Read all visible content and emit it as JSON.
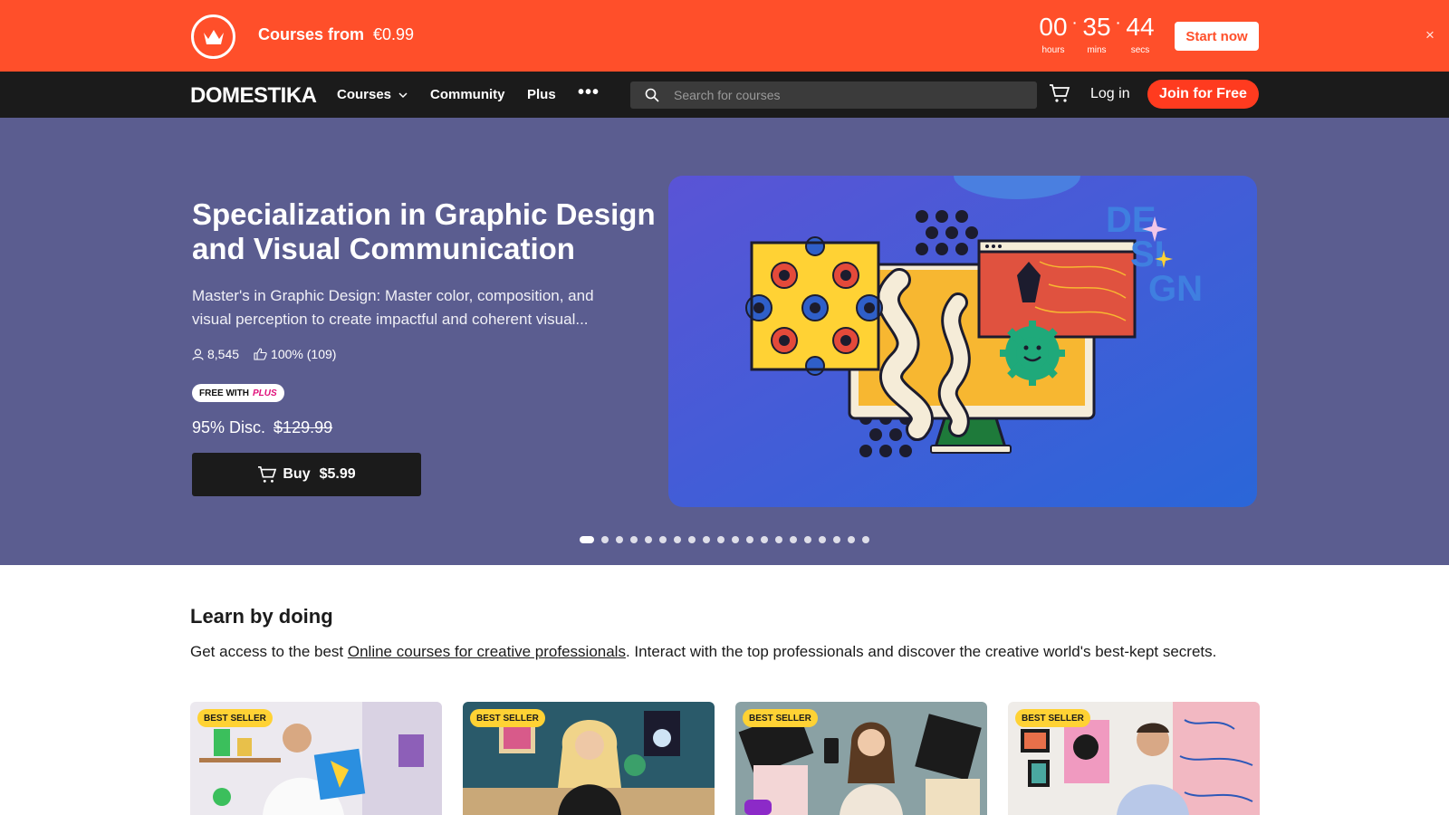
{
  "promo": {
    "title": "Courses from",
    "price": "€0.99",
    "timer": [
      {
        "value": "00",
        "label": "hours"
      },
      {
        "value": "35",
        "label": "mins"
      },
      {
        "value": "44",
        "label": "secs"
      }
    ],
    "cta": "Start now",
    "close": "×"
  },
  "nav": {
    "brand": "DOMESTIKA",
    "items": [
      "Courses",
      "Community",
      "Plus"
    ],
    "more": "•••",
    "search_placeholder": "Search for courses",
    "login": "Log in",
    "join": "Join for Free"
  },
  "hero": {
    "title": "Specialization in Graphic Design and Visual Communication",
    "description": "Master's in Graphic Design: Master color, composition, and visual perception to create impactful and coherent visual...",
    "students": "8,545",
    "rating": "100% (109)",
    "badge_free": "FREE WITH",
    "badge_plus": "PLUS",
    "discount": "95% Disc.",
    "old_price": "$129.99",
    "buy_label": "Buy",
    "buy_price": "$5.99",
    "art_text": [
      "DE",
      "SI",
      "GN"
    ],
    "slide_count": 20,
    "active_slide": 0
  },
  "learn": {
    "title": "Learn by doing",
    "desc_before": "Get access to the best ",
    "desc_link": "Online courses for creative professionals",
    "desc_after": ". Interact with the top professionals and discover the creative world's best-kept secrets."
  },
  "cards": [
    {
      "badge": "BEST SELLER"
    },
    {
      "badge": "BEST SELLER"
    },
    {
      "badge": "BEST SELLER"
    },
    {
      "badge": "BEST SELLER"
    }
  ],
  "colors": {
    "promo": "#ff4f2a",
    "nav": "#1b1b1b",
    "hero": "#5b5d90",
    "join": "#ff3b1f",
    "badge": "#ffd234"
  }
}
